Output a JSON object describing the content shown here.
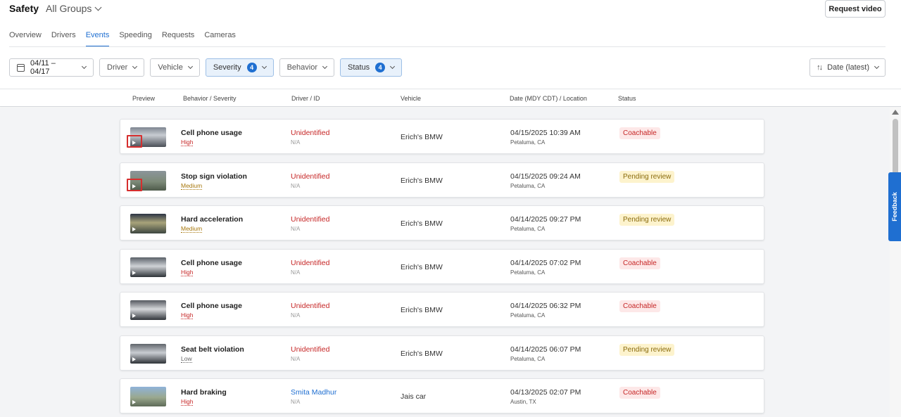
{
  "header": {
    "title": "Safety",
    "group": "All Groups",
    "request_video": "Request video"
  },
  "tabs": [
    {
      "label": "Overview"
    },
    {
      "label": "Drivers"
    },
    {
      "label": "Events"
    },
    {
      "label": "Speeding"
    },
    {
      "label": "Requests"
    },
    {
      "label": "Cameras"
    }
  ],
  "active_tab": "Events",
  "filters": {
    "date_range": "04/11 – 04/17",
    "driver": "Driver",
    "vehicle": "Vehicle",
    "severity": "Severity",
    "severity_count": "4",
    "behavior": "Behavior",
    "status": "Status",
    "status_count": "4",
    "sort": "Date (latest)"
  },
  "columns": {
    "preview": "Preview",
    "behavior": "Behavior / Severity",
    "driver": "Driver / ID",
    "vehicle": "Vehicle",
    "date": "Date (MDY CDT) / Location",
    "status": "Status"
  },
  "events": [
    {
      "behavior": "Cell phone usage",
      "severity": "High",
      "driver": "Unidentified",
      "driver_id": "N/A",
      "vehicle": "Erich's BMW",
      "date": "04/15/2025 10:39 AM",
      "location": "Petaluma, CA",
      "status": "Coachable"
    },
    {
      "behavior": "Stop sign violation",
      "severity": "Medium",
      "driver": "Unidentified",
      "driver_id": "N/A",
      "vehicle": "Erich's BMW",
      "date": "04/15/2025 09:24 AM",
      "location": "Petaluma, CA",
      "status": "Pending review"
    },
    {
      "behavior": "Hard acceleration",
      "severity": "Medium",
      "driver": "Unidentified",
      "driver_id": "N/A",
      "vehicle": "Erich's BMW",
      "date": "04/14/2025 09:27 PM",
      "location": "Petaluma, CA",
      "status": "Pending review"
    },
    {
      "behavior": "Cell phone usage",
      "severity": "High",
      "driver": "Unidentified",
      "driver_id": "N/A",
      "vehicle": "Erich's BMW",
      "date": "04/14/2025 07:02 PM",
      "location": "Petaluma, CA",
      "status": "Coachable"
    },
    {
      "behavior": "Cell phone usage",
      "severity": "High",
      "driver": "Unidentified",
      "driver_id": "N/A",
      "vehicle": "Erich's BMW",
      "date": "04/14/2025 06:32 PM",
      "location": "Petaluma, CA",
      "status": "Coachable"
    },
    {
      "behavior": "Seat belt violation",
      "severity": "Low",
      "driver": "Unidentified",
      "driver_id": "N/A",
      "vehicle": "Erich's BMW",
      "date": "04/14/2025 06:07 PM",
      "location": "Petaluma, CA",
      "status": "Pending review"
    },
    {
      "behavior": "Hard braking",
      "severity": "High",
      "driver": "Smita Madhur",
      "driver_id": "N/A",
      "vehicle": "Jais car",
      "date": "04/13/2025 02:07 PM",
      "location": "Austin, TX",
      "status": "Coachable"
    }
  ],
  "feedback": "Feedback",
  "colors": {
    "accent": "#1f6fd1",
    "high": "#c62626",
    "medium": "#a7770c",
    "low": "#666666",
    "unidentified": "#c62626",
    "named_driver": "#1f6fd1"
  }
}
